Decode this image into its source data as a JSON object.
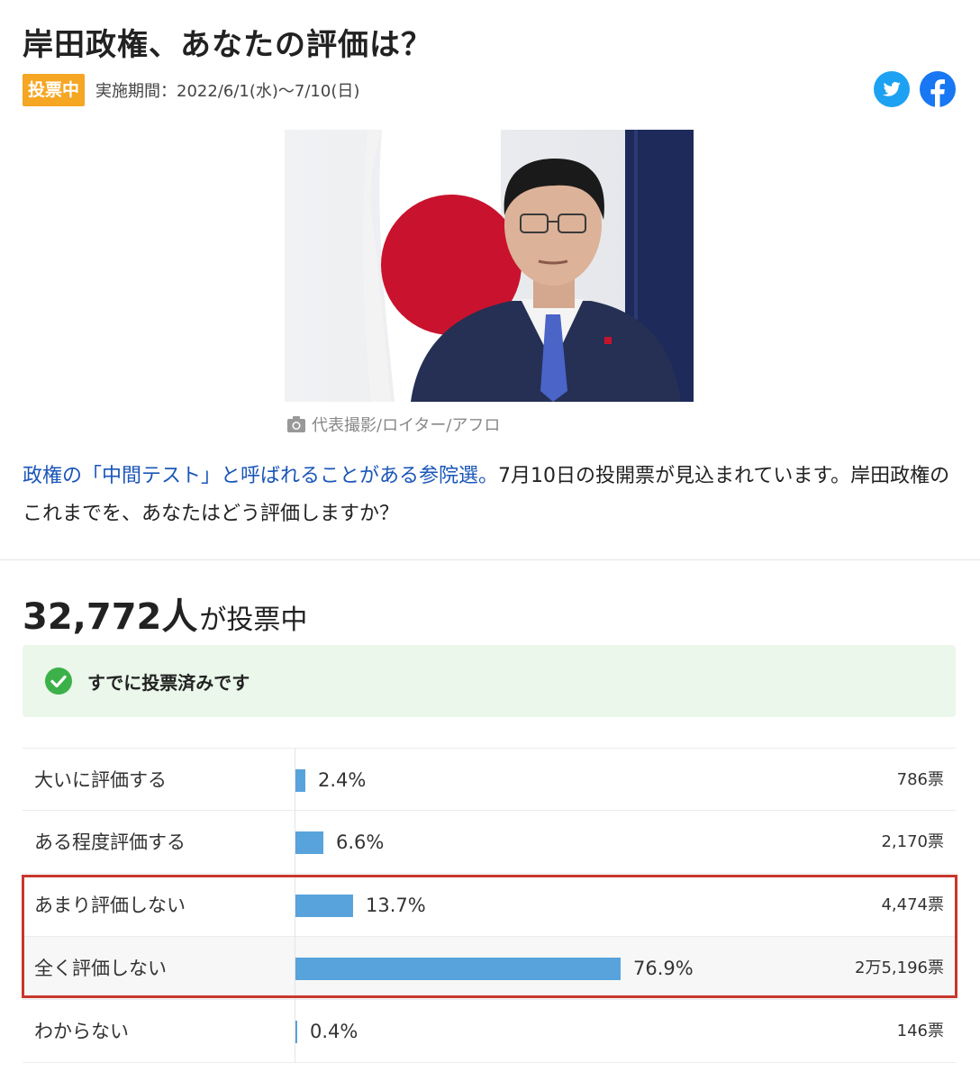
{
  "title": "岸田政権、あなたの評価は？",
  "status_badge": "投票中",
  "period": "実施期間：2022/6/1(水)〜7/10(日)",
  "social": {
    "twitter_icon": "twitter-icon",
    "facebook_icon": "facebook-icon"
  },
  "photo": {
    "caption": "代表撮影/ロイター/アフロ",
    "caption_icon": "camera-icon"
  },
  "description": {
    "lead": "政権の「中間テスト」と呼ばれることがある参院選。",
    "body": "7月10日の投開票が見込まれています。岸田政権のこれまでを、あなたはどう評価しますか？"
  },
  "vote_count": {
    "number": "32,772人",
    "suffix": "が投票中"
  },
  "voted_notice": {
    "text": "すでに投票済みです",
    "icon": "check-circle-icon",
    "color": "#3cb14a"
  },
  "colors": {
    "bar": "#58a3dc",
    "badge": "#f5a623",
    "highlight": "#c8372d",
    "link": "#1a56b8"
  },
  "results": [
    {
      "label": "大いに評価する",
      "percent": 2.4,
      "percent_text": "2.4%",
      "votes": "786票"
    },
    {
      "label": "ある程度評価する",
      "percent": 6.6,
      "percent_text": "6.6%",
      "votes": "2,170票"
    },
    {
      "label": "あまり評価しない",
      "percent": 13.7,
      "percent_text": "13.7%",
      "votes": "4,474票"
    },
    {
      "label": "全く評価しない",
      "percent": 76.9,
      "percent_text": "76.9%",
      "votes": "2万5,196票"
    },
    {
      "label": "わからない",
      "percent": 0.4,
      "percent_text": "0.4%",
      "votes": "146票"
    }
  ]
}
